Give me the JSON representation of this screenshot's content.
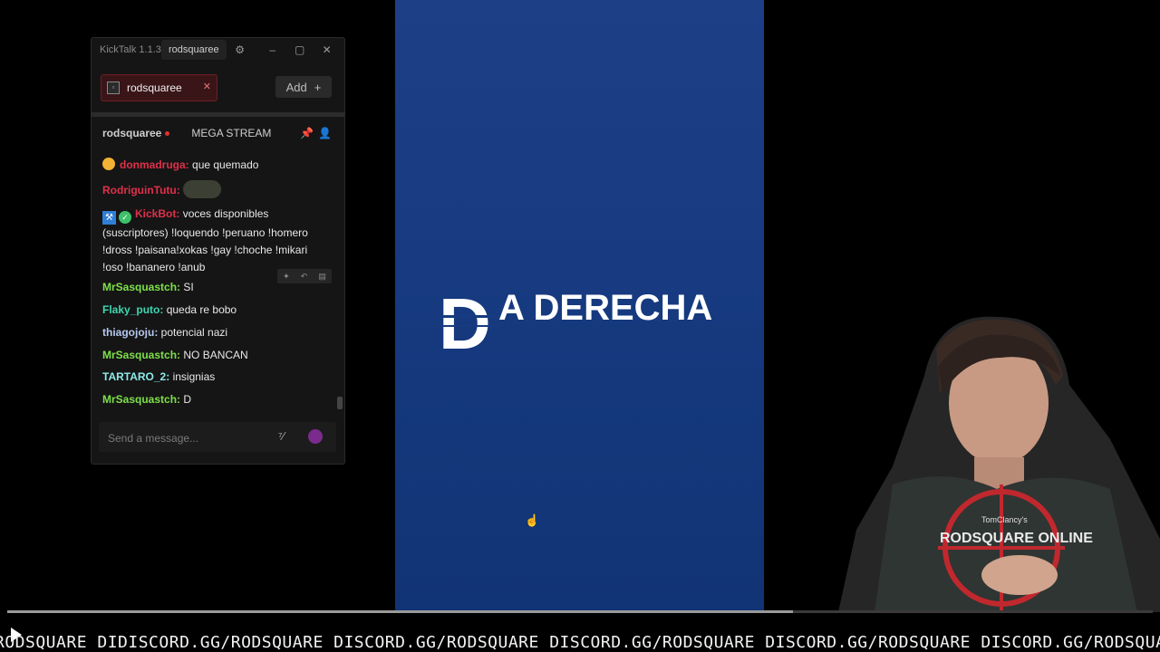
{
  "titlebar": {
    "app_name": "KickTalk 1.1.3",
    "user": "rodsquaree"
  },
  "channel_tab": {
    "label": "rodsquaree"
  },
  "add_button": {
    "label": "Add",
    "icon": "+"
  },
  "chat_header": {
    "channel": "rodsquaree",
    "stream_title": "MEGA STREAM"
  },
  "messages": [
    {
      "user": "donmadruga:",
      "user_color": "#e0304a",
      "text": "que quemado"
    },
    {
      "user": "RodriguinTutu:",
      "user_color": "#e0304a",
      "text": ""
    },
    {
      "user": "KickBot:",
      "user_color": "#e0304a",
      "text": "voces disponibles (suscriptores) !loquendo !peruano !homero !dross !paisana!xokas !gay !choche !mikari !oso !bananero !anub"
    },
    {
      "user": "MrSasquastch:",
      "user_color": "#7ee04a",
      "text": "SI"
    },
    {
      "user": "Flaky_puto:",
      "user_color": "#3fd6b0",
      "text": "queda re bobo"
    },
    {
      "user": "thiagojoju:",
      "user_color": "#b5c8ee",
      "text": "potencial nazi"
    },
    {
      "user": "MrSasquastch:",
      "user_color": "#7ee04a",
      "text": "NO BANCAN"
    },
    {
      "user": "TARTARO_2:",
      "user_color": "#8fe9e9",
      "text": "insignias"
    },
    {
      "user": "MrSasquastch:",
      "user_color": "#7ee04a",
      "text": "D"
    }
  ],
  "input": {
    "placeholder": "Send a message..."
  },
  "video": {
    "logo_letter": "D",
    "logo_text": "A DERECHA"
  },
  "cam_shirt": {
    "line1": "TomClancy's",
    "line2": "RODSQUARE ONLINE"
  },
  "progress": {
    "fraction": 0.686
  },
  "ticker": {
    "text": "RODSQUARE DIDISCORD.GG/RODSQUARE DISCORD.GG/RODSQUARE DISCORD.GG/RODSQUARE DISCORD.GG/RODSQUARE DISCORD.GG/RODSQUARE DISCORD.GG/"
  },
  "icons": {
    "gear": "gear-icon",
    "minimize": "minimize-icon",
    "maximize": "maximize-icon",
    "close": "close-icon",
    "pin": "pin-icon",
    "user": "user-icon",
    "reply": "reply-icon",
    "copy": "copy-icon",
    "translate": "translate-icon",
    "emote": "emote-icon",
    "play": "play-icon"
  }
}
